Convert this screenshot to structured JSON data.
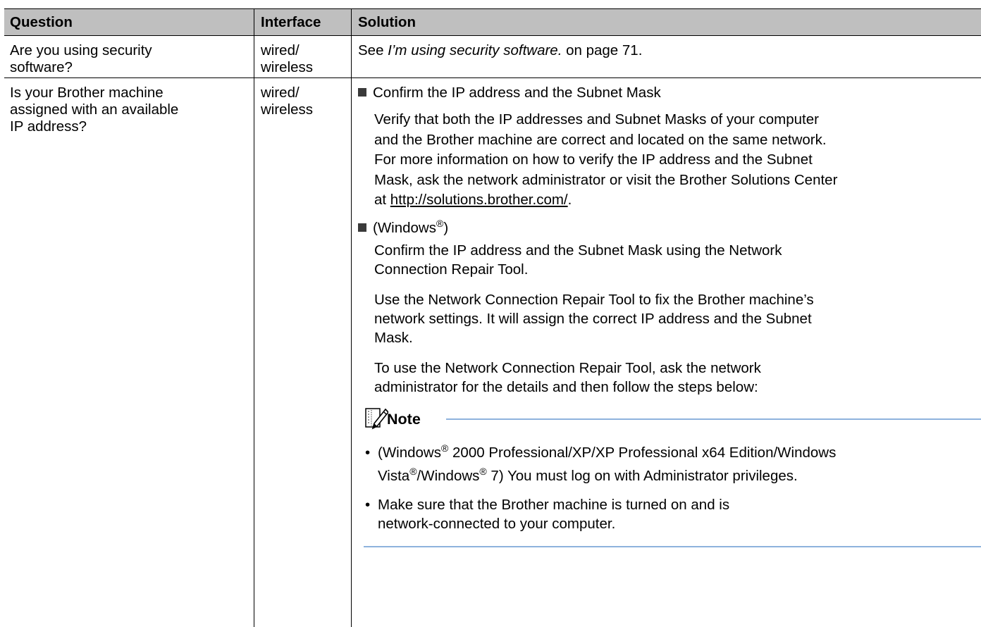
{
  "table": {
    "headers": {
      "question": "Question",
      "interface": "Interface",
      "solution": "Solution"
    },
    "row1": {
      "question_l1": "Are you using security",
      "question_l2": "software?",
      "interface_l1": "wired/",
      "interface_l2": "wireless",
      "solution_pre": "See ",
      "solution_ref": "I’m using security software.",
      "solution_post": " on page 71."
    },
    "row2": {
      "question_l1": "Is your Brother machine",
      "question_l2": "assigned with an available",
      "question_l3": "IP address?",
      "interface_l1": "wired/",
      "interface_l2": "wireless",
      "item1_heading": "Confirm the IP address and the Subnet Mask",
      "item1_p1": "Verify that both the IP addresses and Subnet Masks of your computer",
      "item1_p2": "and the Brother machine are correct and located on the same network.",
      "item1_p3": "For more information on how to verify the IP address and the Subnet",
      "item1_p4": "Mask, ask the network administrator or visit the Brother Solutions Center",
      "item1_p5_pre": "at ",
      "item1_link": "http://solutions.brother.com/",
      "item1_p5_post": ".",
      "item2_heading_pre": "(Windows",
      "item2_reg": "®",
      "item2_heading_post": ")",
      "item2_l1": "Confirm the IP address and the Subnet Mask using the Network",
      "item2_l2": "Connection Repair Tool.",
      "item2_p1": "Use the Network Connection Repair Tool to fix the Brother machine’s",
      "item2_p2": "network settings. It will assign the correct IP address and the Subnet",
      "item2_p3": "Mask.",
      "item2_p4": "To use the Network Connection Repair Tool, ask the network",
      "item2_p5": "administrator for the details and then follow the steps below:",
      "note_title": "Note",
      "note1_a": "(Windows",
      "note1_reg1": "®",
      "note1_b": " 2000 Professional/XP/XP Professional x64 Edition/Windows",
      "note1_c": "Vista",
      "note1_reg2": "®",
      "note1_d": "/Windows",
      "note1_reg3": "®",
      "note1_e": " 7) You must log on with Administrator privileges.",
      "note2_l1": "Make sure that the Brother machine is turned on and is",
      "note2_l2": "network-connected to your computer."
    }
  }
}
